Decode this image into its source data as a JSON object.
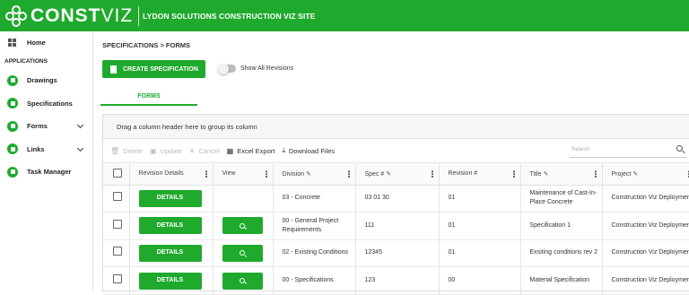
{
  "header": {
    "logo_bold": "CONST",
    "logo_thin": "VIZ",
    "site_name": "LYDON SOLUTIONS CONSTRUCTION VIZ SITE",
    "brand_color": "#1faa2d"
  },
  "sidebar": {
    "home_label": "Home",
    "section_label": "APPLICATIONS",
    "items": [
      {
        "label": "Drawings",
        "icon": "drawings-icon"
      },
      {
        "label": "Specifications",
        "icon": "specifications-icon"
      },
      {
        "label": "Forms",
        "icon": "forms-icon",
        "expandable": true
      },
      {
        "label": "Links",
        "icon": "links-icon",
        "expandable": true
      },
      {
        "label": "Task Manager",
        "icon": "task-manager-icon"
      }
    ]
  },
  "main": {
    "breadcrumb": "SPECIFICATIONS > FORMS",
    "create_button": "CREATE SPECIFICATION",
    "toggle_label": "Show All Revisions",
    "tab_label": "FORMS",
    "group_hint": "Drag a column header here to group its column",
    "toolbar": {
      "delete": "Delete",
      "update": "Update",
      "cancel": "Cancel",
      "excel": "Excel Export",
      "download": "Download Files",
      "search_placeholder": "Search"
    },
    "columns": [
      "Revision Details",
      "View",
      "Division",
      "Spec #",
      "Revision #",
      "Title",
      "Project"
    ],
    "details_label": "DETAILS",
    "rows": [
      {
        "has_view": false,
        "division": "03 - Concrete",
        "spec": "03 01 30",
        "revision": "01",
        "title": "Maintenance of Cast-In-Place Concrete",
        "project": "Construction Viz Deployment"
      },
      {
        "has_view": true,
        "division": "00 - General Project Requirements",
        "spec": "111",
        "revision": "01",
        "title": "Specification 1",
        "project": "Construction Viz Deployment"
      },
      {
        "has_view": true,
        "division": "02 - Existing Conditions",
        "spec": "12345",
        "revision": "01",
        "title": "Exsiting conditions rev 2",
        "project": "Construction Viz Deployment"
      },
      {
        "has_view": true,
        "division": "00 - Specifications",
        "spec": "123",
        "revision": "00",
        "title": "Material Specification",
        "project": "Construction Viz Deployment"
      }
    ]
  }
}
